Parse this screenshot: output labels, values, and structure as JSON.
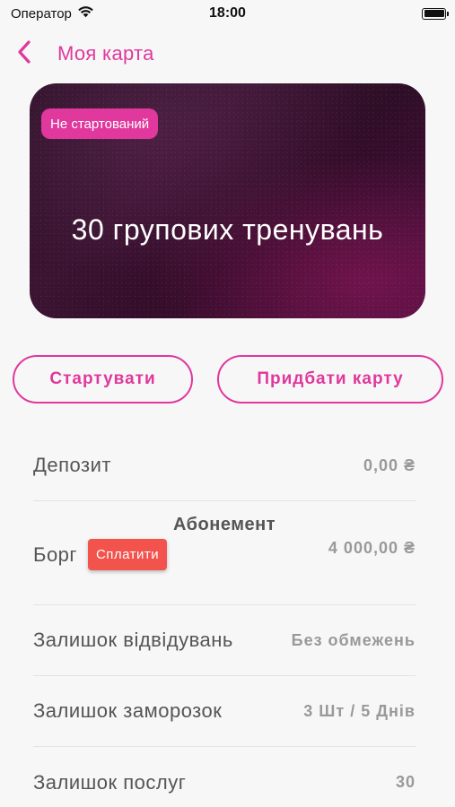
{
  "status_bar": {
    "carrier": "Оператор",
    "time": "18:00"
  },
  "nav": {
    "title": "Моя карта"
  },
  "card": {
    "badge": "Не стартований",
    "title": "30 групових тренувань"
  },
  "actions": {
    "start_label": "Стартувати",
    "buy_label": "Придбати карту"
  },
  "details": {
    "deposit": {
      "label": "Депозит",
      "value": "0,00 ₴"
    },
    "section_title": "Абонемент",
    "debt": {
      "label": "Борг",
      "pay_label": "Сплатити",
      "value": "4 000,00 ₴"
    },
    "visits_left": {
      "label": "Залишок відвідувань",
      "value": "Без обмежень"
    },
    "freezes_left": {
      "label": "Залишок заморозок",
      "value": "3 Шт / 5 Днів"
    },
    "services_left": {
      "label": "Залишок послуг",
      "value": "30"
    }
  },
  "colors": {
    "accent": "#e0389d",
    "pay_button": "#f2534d",
    "background": "#f7f7f7"
  }
}
